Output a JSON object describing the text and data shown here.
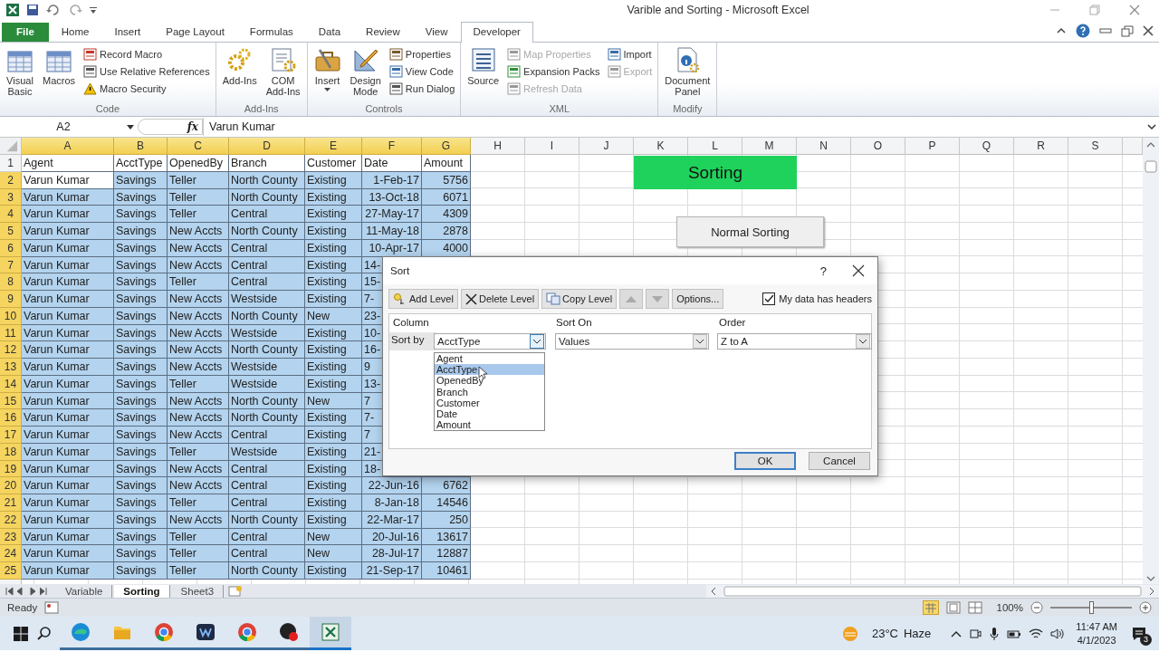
{
  "window": {
    "title": "Varible and Sorting  -  Microsoft Excel"
  },
  "tabs": [
    {
      "label": "File",
      "kind": "file",
      "selected": false
    },
    {
      "label": "Home",
      "kind": "tab",
      "selected": false
    },
    {
      "label": "Insert",
      "kind": "tab",
      "selected": false
    },
    {
      "label": "Page Layout",
      "kind": "tab",
      "selected": false
    },
    {
      "label": "Formulas",
      "kind": "tab",
      "selected": false
    },
    {
      "label": "Data",
      "kind": "tab",
      "selected": false
    },
    {
      "label": "Review",
      "kind": "tab",
      "selected": false
    },
    {
      "label": "View",
      "kind": "tab",
      "selected": false
    },
    {
      "label": "Developer",
      "kind": "tab",
      "selected": true
    }
  ],
  "ribbon": [
    {
      "label": "Code",
      "columns": [
        {
          "kind": "large",
          "label": "Visual Basic"
        },
        {
          "kind": "large",
          "label": "Macros"
        },
        {
          "kind": "stack",
          "items": [
            {
              "label": "Record Macro",
              "disabled": false
            },
            {
              "label": "Use Relative References",
              "disabled": false
            },
            {
              "label": "Macro Security",
              "disabled": false
            }
          ]
        }
      ]
    },
    {
      "label": "Add-Ins",
      "columns": [
        {
          "kind": "large",
          "label": "Add-Ins"
        },
        {
          "kind": "large",
          "label": "COM Add-Ins"
        }
      ]
    },
    {
      "label": "Controls",
      "columns": [
        {
          "kind": "menu",
          "label": "Insert"
        },
        {
          "kind": "large",
          "label": "Design Mode"
        },
        {
          "kind": "stack",
          "items": [
            {
              "label": "Properties",
              "disabled": false
            },
            {
              "label": "View Code",
              "disabled": false
            },
            {
              "label": "Run Dialog",
              "disabled": false
            }
          ]
        }
      ]
    },
    {
      "label": "XML",
      "columns": [
        {
          "kind": "large",
          "label": "Source"
        },
        {
          "kind": "stack",
          "items": [
            {
              "label": "Map Properties",
              "disabled": true
            },
            {
              "label": "Expansion Packs",
              "disabled": false
            },
            {
              "label": "Refresh Data",
              "disabled": true
            }
          ]
        },
        {
          "kind": "stack",
          "items": [
            {
              "label": "Import",
              "disabled": false
            },
            {
              "label": "Export",
              "disabled": true
            }
          ]
        }
      ]
    },
    {
      "label": "Modify",
      "columns": [
        {
          "kind": "large",
          "label": "Document Panel"
        }
      ]
    }
  ],
  "formula_bar": {
    "name_box": "A2",
    "function_label": "fx",
    "value": "Varun Kumar"
  },
  "sheet": {
    "columns": [
      {
        "label": "A",
        "selected": true
      },
      {
        "label": "B",
        "selected": true
      },
      {
        "label": "C",
        "selected": true
      },
      {
        "label": "D",
        "selected": true
      },
      {
        "label": "E",
        "selected": true
      },
      {
        "label": "F",
        "selected": true
      },
      {
        "label": "G",
        "selected": true
      },
      {
        "label": "H",
        "selected": false
      },
      {
        "label": "I",
        "selected": false
      },
      {
        "label": "J",
        "selected": false
      },
      {
        "label": "K",
        "selected": false
      },
      {
        "label": "L",
        "selected": false
      },
      {
        "label": "M",
        "selected": false
      },
      {
        "label": "N",
        "selected": false
      },
      {
        "label": "O",
        "selected": false
      },
      {
        "label": "P",
        "selected": false
      },
      {
        "label": "Q",
        "selected": false
      },
      {
        "label": "R",
        "selected": false
      },
      {
        "label": "S",
        "selected": false
      }
    ],
    "rows": [
      {
        "n": "1",
        "selected": false,
        "cells": [
          "Agent",
          "AcctType",
          "OpenedBy",
          "Branch",
          "Customer",
          "Date",
          "Amount"
        ]
      },
      {
        "n": "2",
        "selected": true,
        "active": true,
        "cells": [
          "Varun Kumar",
          "Savings",
          "Teller",
          "North County",
          "Existing",
          "1-Feb-17",
          "5756"
        ]
      },
      {
        "n": "3",
        "selected": true,
        "active": false,
        "cells": [
          "Varun Kumar",
          "Savings",
          "Teller",
          "North County",
          "Existing",
          "13-Oct-18",
          "6071"
        ]
      },
      {
        "n": "4",
        "selected": true,
        "active": false,
        "cells": [
          "Varun Kumar",
          "Savings",
          "Teller",
          "Central",
          "Existing",
          "27-May-17",
          "4309"
        ]
      },
      {
        "n": "5",
        "selected": true,
        "active": false,
        "cells": [
          "Varun Kumar",
          "Savings",
          "New Accts",
          "North County",
          "Existing",
          "11-May-18",
          "2878"
        ]
      },
      {
        "n": "6",
        "selected": true,
        "active": false,
        "cells": [
          "Varun Kumar",
          "Savings",
          "New Accts",
          "Central",
          "Existing",
          "10-Apr-17",
          "4000"
        ]
      },
      {
        "n": "7",
        "selected": true,
        "active": false,
        "cells": [
          "Varun Kumar",
          "Savings",
          "New Accts",
          "Central",
          "Existing",
          "14-"
        ]
      },
      {
        "n": "8",
        "selected": true,
        "active": false,
        "cells": [
          "Varun Kumar",
          "Savings",
          "Teller",
          "Central",
          "Existing",
          "15-"
        ]
      },
      {
        "n": "9",
        "selected": true,
        "active": false,
        "cells": [
          "Varun Kumar",
          "Savings",
          "New Accts",
          "Westside",
          "Existing",
          "7-"
        ]
      },
      {
        "n": "10",
        "selected": true,
        "active": false,
        "cells": [
          "Varun Kumar",
          "Savings",
          "New Accts",
          "North County",
          "New",
          "23-"
        ]
      },
      {
        "n": "11",
        "selected": true,
        "active": false,
        "cells": [
          "Varun Kumar",
          "Savings",
          "New Accts",
          "Westside",
          "Existing",
          "10-"
        ]
      },
      {
        "n": "12",
        "selected": true,
        "active": false,
        "cells": [
          "Varun Kumar",
          "Savings",
          "New Accts",
          "North County",
          "Existing",
          "16-"
        ]
      },
      {
        "n": "13",
        "selected": true,
        "active": false,
        "cells": [
          "Varun Kumar",
          "Savings",
          "New Accts",
          "Westside",
          "Existing",
          "9"
        ]
      },
      {
        "n": "14",
        "selected": true,
        "active": false,
        "cells": [
          "Varun Kumar",
          "Savings",
          "Teller",
          "Westside",
          "Existing",
          "13-"
        ]
      },
      {
        "n": "15",
        "selected": true,
        "active": false,
        "cells": [
          "Varun Kumar",
          "Savings",
          "New Accts",
          "North County",
          "New",
          "7"
        ]
      },
      {
        "n": "16",
        "selected": true,
        "active": false,
        "cells": [
          "Varun Kumar",
          "Savings",
          "New Accts",
          "North County",
          "Existing",
          "7-"
        ]
      },
      {
        "n": "17",
        "selected": true,
        "active": false,
        "cells": [
          "Varun Kumar",
          "Savings",
          "New Accts",
          "Central",
          "Existing",
          "7"
        ]
      },
      {
        "n": "18",
        "selected": true,
        "active": false,
        "cells": [
          "Varun Kumar",
          "Savings",
          "Teller",
          "Westside",
          "Existing",
          "21-"
        ]
      },
      {
        "n": "19",
        "selected": true,
        "active": false,
        "cells": [
          "Varun Kumar",
          "Savings",
          "New Accts",
          "Central",
          "Existing",
          "18-"
        ]
      },
      {
        "n": "20",
        "selected": true,
        "active": false,
        "cells": [
          "Varun Kumar",
          "Savings",
          "New Accts",
          "Central",
          "Existing",
          "22-Jun-16",
          "6762"
        ]
      },
      {
        "n": "21",
        "selected": true,
        "active": false,
        "cells": [
          "Varun Kumar",
          "Savings",
          "Teller",
          "Central",
          "Existing",
          "8-Jan-18",
          "14546"
        ]
      },
      {
        "n": "22",
        "selected": true,
        "active": false,
        "cells": [
          "Varun Kumar",
          "Savings",
          "New Accts",
          "North County",
          "Existing",
          "22-Mar-17",
          "250"
        ]
      },
      {
        "n": "23",
        "selected": true,
        "active": false,
        "cells": [
          "Varun Kumar",
          "Savings",
          "Teller",
          "Central",
          "New",
          "20-Jul-16",
          "13617"
        ]
      },
      {
        "n": "24",
        "selected": true,
        "active": false,
        "cells": [
          "Varun Kumar",
          "Savings",
          "Teller",
          "Central",
          "New",
          "28-Jul-17",
          "12887"
        ]
      },
      {
        "n": "25",
        "selected": true,
        "active": false,
        "cells": [
          "Varun Kumar",
          "Savings",
          "Teller",
          "North County",
          "Existing",
          "21-Sep-17",
          "10461"
        ]
      }
    ],
    "shapes": [
      {
        "kind": "label",
        "text": "Sorting"
      },
      {
        "kind": "button",
        "text": "Normal Sorting"
      }
    ]
  },
  "sort_dialog": {
    "title": "Sort",
    "help": "?",
    "toolbar": [
      {
        "kind": "add",
        "label": "Add Level",
        "disabled": false
      },
      {
        "kind": "delete",
        "label": "Delete Level",
        "disabled": false
      },
      {
        "kind": "copy",
        "label": "Copy Level",
        "disabled": false
      },
      {
        "kind": "up",
        "disabled": true
      },
      {
        "kind": "down",
        "disabled": true
      },
      {
        "kind": "text",
        "label": "Options...",
        "disabled": false
      }
    ],
    "headers_checkbox": {
      "label": "My data has headers",
      "checked": true
    },
    "headings": [
      "Column",
      "Sort On",
      "Order"
    ],
    "row_label": "Sort by",
    "column_value": "AcctType",
    "sort_on_value": "Values",
    "order_value": "Z to A",
    "dropdown": [
      {
        "label": "Agent",
        "selected": false
      },
      {
        "label": "AcctType",
        "selected": true
      },
      {
        "label": "OpenedBy",
        "selected": false
      },
      {
        "label": "Branch",
        "selected": false
      },
      {
        "label": "Customer",
        "selected": false
      },
      {
        "label": "Date",
        "selected": false
      },
      {
        "label": "Amount",
        "selected": false
      }
    ],
    "buttons": [
      {
        "label": "OK",
        "kind": "default"
      },
      {
        "label": "Cancel",
        "kind": "normal"
      }
    ]
  },
  "sheet_tabs": [
    {
      "label": "Variable",
      "selected": false
    },
    {
      "label": "Sorting",
      "selected": true
    },
    {
      "label": "Sheet3",
      "selected": false
    }
  ],
  "status_bar": {
    "text": "Ready",
    "zoom": "100%",
    "level": 0.5
  },
  "taskbar": {
    "apps": [
      {
        "running": true,
        "selected": false
      },
      {
        "running": true,
        "selected": false
      },
      {
        "running": true,
        "selected": false
      },
      {
        "running": true,
        "selected": false
      },
      {
        "running": true,
        "selected": false
      },
      {
        "running": true,
        "selected": false
      },
      {
        "running": true,
        "selected": true
      }
    ],
    "temperature": "23°C",
    "weather": "Haze",
    "time": "11:47 AM",
    "date": "4/1/2023",
    "notifications": "3"
  }
}
